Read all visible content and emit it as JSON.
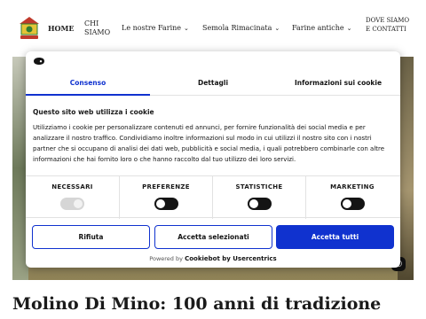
{
  "nav": {
    "items": [
      {
        "label": "HOME"
      },
      {
        "label": "CHI SIAMO"
      },
      {
        "label": "Le nostre Farine"
      },
      {
        "label": "Semola Rimacinata"
      },
      {
        "label": "Farine antiche"
      },
      {
        "label": "DOVE SIAMO E CONTATTI"
      }
    ]
  },
  "cookie_dialog": {
    "tabs": [
      {
        "label": "Consenso",
        "selected": true
      },
      {
        "label": "Dettagli",
        "selected": false
      },
      {
        "label": "Informazioni sui cookie",
        "selected": false
      }
    ],
    "title": "Questo sito web utilizza i cookie",
    "body": "Utilizziamo i cookie per personalizzare contenuti ed annunci, per fornire funzionalità dei social media e per analizzare il nostro traffico. Condividiamo inoltre informazioni sul modo in cui utilizzi il nostro sito con i nostri partner che si occupano di analisi dei dati web, pubblicità e social media, i quali potrebbero combinarle con altre informazioni che hai fornito loro o che hanno raccolto dal tuo utilizzo dei loro servizi.",
    "toggles": [
      {
        "label": "NECESSARI",
        "state": "locked-on"
      },
      {
        "label": "PREFERENZE",
        "state": "off"
      },
      {
        "label": "STATISTICHE",
        "state": "off"
      },
      {
        "label": "MARKETING",
        "state": "off"
      }
    ],
    "buttons": {
      "reject": "Rifiuta",
      "accept_selected": "Accetta selezionati",
      "accept_all": "Accetta tutti"
    },
    "powered_prefix": "Powered by",
    "powered_brand": "Cookiebot by Usercentrics"
  },
  "colors": {
    "accent": "#1032cf",
    "logo_red": "#c0392b",
    "logo_yellow": "#e3c437",
    "logo_green": "#2e7d32"
  },
  "page": {
    "title": "Molino Di Mino: 100 anni di tradizione"
  }
}
